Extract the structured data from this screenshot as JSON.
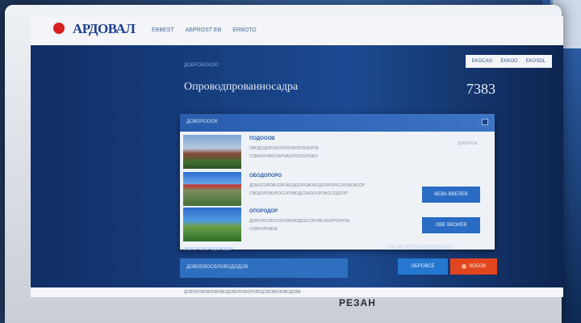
{
  "header": {
    "logo_text": "АРДОВАЛ",
    "nav": [
      "EBBEST",
      "ABPROST EB",
      "ERBOTO"
    ]
  },
  "subnav": [
    "EKOCAO",
    "EKKOO",
    "EKOSDL"
  ],
  "breadcrumb": "ДОБРОБОАОО",
  "page_title": "Опроводпрованносадра",
  "page_count": "7383",
  "panel": {
    "title": "ДОВОРОООК",
    "rows": [
      {
        "title": "ПОДОООВ",
        "line1": "ОВОДОДОРОБОСРООБОРООЕРОБ",
        "line2": "СЛИБОРОВОСАРОАОРООСЕРОБО",
        "button": "",
        "tag": "ДОБОРОЕ"
      },
      {
        "title": "ОБОДОПОРО",
        "line1": "ДОБОСОРОВООРОБОДООРОВОБОДООРОРСОЛОБОВСОР",
        "line2": "СВОДОРОВОРОСОРОВОДСОКОООРОБОСОДООР",
        "button": "ВЕВА ВВЕЛЕВ",
        "tag": ""
      },
      {
        "title": "ОПОРОДОР",
        "line1": "ДОВОЛОСВОСОООВОКОДОЕСОРОВСАБОРООРОЕ",
        "line2": "СОВЛОРОВОЕ",
        "button": "ОВЕ ВКОИЕВ",
        "tag": ""
      }
    ]
  },
  "bottom": {
    "left_caption": "ЖОВОРОВОРОДОВОДОР",
    "left_label": "ДОВОЕВОСВЛОВОДОДОВ",
    "mid_caption": "100  ВЕЛЕЛООВОСВЕВОЖО",
    "mid_button": "ОБРОВСЕ",
    "red_button": "ЭОБОВ"
  },
  "footer_text": "ДОВОРОВОВЛОВОВОДОВОЛОВОРОВОДОБОВОЛОВОДОВЕ",
  "monitor_brand": "РЕЗАН"
}
